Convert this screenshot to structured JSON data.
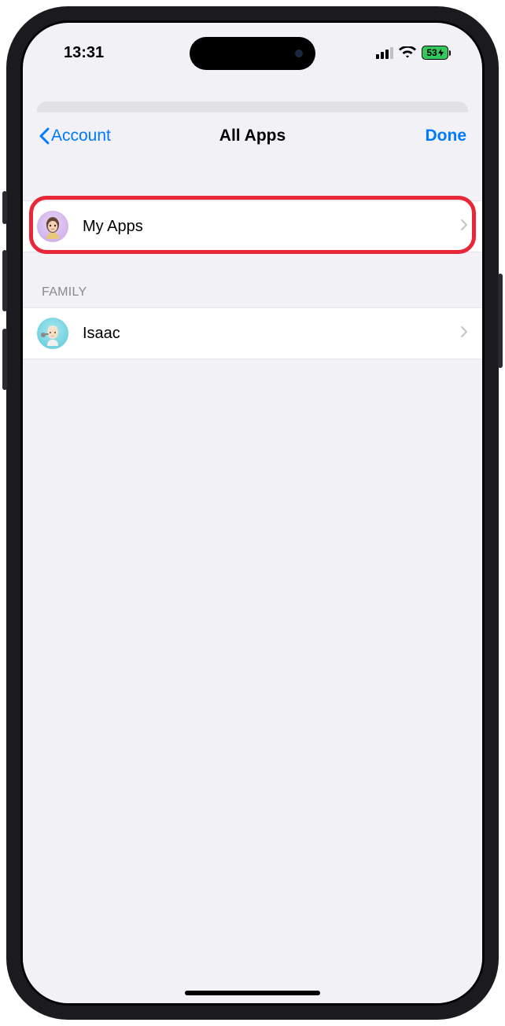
{
  "status": {
    "time": "13:31",
    "battery": "53"
  },
  "nav": {
    "back": "Account",
    "title": "All Apps",
    "done": "Done"
  },
  "sections": {
    "my": {
      "label": "My Apps"
    },
    "family": {
      "header": "FAMILY",
      "items": [
        {
          "label": "Isaac"
        }
      ]
    }
  }
}
